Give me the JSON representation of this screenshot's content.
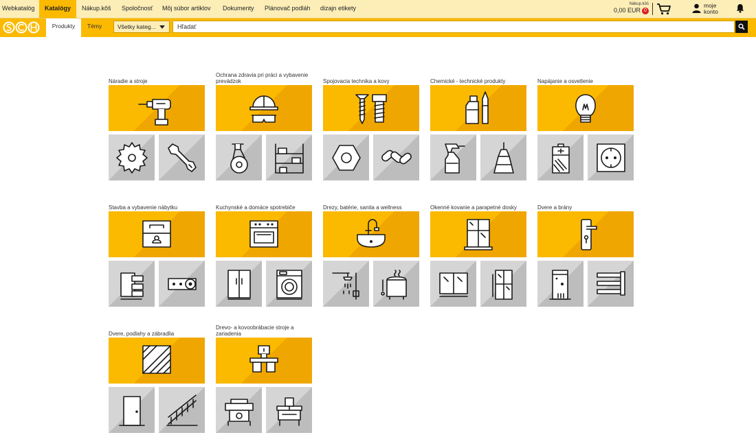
{
  "nav": {
    "items": [
      "Webkatalóg",
      "Katalógy",
      "Nákup.kôš",
      "Spoločnosť",
      "Môj súbor artiklov",
      "Dokumenty",
      "Plánovač podláh",
      "dizajn etikety"
    ],
    "active_index": 1
  },
  "cart": {
    "label": "Nákup.kôš",
    "amount": "0,00 EUR",
    "count": "0"
  },
  "account": {
    "label": "moje konto"
  },
  "searchbar": {
    "tab_products": "Produkty",
    "tab_topics": "Témy",
    "category_select": "Všetky kateg...",
    "search_placeholder": "Hľadať"
  },
  "colors": {
    "brand_yellow": "#fbb900",
    "nav_bg": "#fdeeb8",
    "tile_grey": "#d5d5d5",
    "badge_red": "#d81f26"
  },
  "categories": [
    {
      "title": "Náradie a stroje",
      "main_icon": "drill-icon",
      "sub_icons": [
        "saw-blade-icon",
        "wrench-icon"
      ]
    },
    {
      "title": "Ochrana zdravia pri práci a vybavenie prevádzok",
      "main_icon": "safety-helmet-goggles-icon",
      "sub_icons": [
        "castor-wheel-icon",
        "shelving-icon"
      ]
    },
    {
      "title": "Spojovacia technika a kovy",
      "main_icon": "screw-bolt-icon",
      "sub_icons": [
        "hex-nut-icon",
        "chain-icon"
      ]
    },
    {
      "title": "Chemické - technické produkty",
      "main_icon": "chemical-bottles-icon",
      "sub_icons": [
        "spray-bottle-icon",
        "glue-bottle-icon"
      ]
    },
    {
      "title": "Napájanie a osvetlenie",
      "main_icon": "light-bulb-icon",
      "sub_icons": [
        "battery-icon",
        "power-socket-icon"
      ]
    },
    {
      "title": "Stavba a vybavenie nábytku",
      "main_icon": "drawers-icon",
      "sub_icons": [
        "drawer-runners-icon",
        "hinge-icon"
      ]
    },
    {
      "title": "Kuchynské a domáce spotrebiče",
      "main_icon": "oven-icon",
      "sub_icons": [
        "fridge-icon",
        "washing-machine-icon"
      ]
    },
    {
      "title": "Drezy, batérie, sanita a wellness",
      "main_icon": "sink-faucet-icon",
      "sub_icons": [
        "shower-icon",
        "sauna-heater-icon"
      ]
    },
    {
      "title": "Okenné kovanie a parapetné dosky",
      "main_icon": "window-icon",
      "sub_icons": [
        "sliding-window-icon",
        "glass-door-icon"
      ]
    },
    {
      "title": "Dvere a brány",
      "main_icon": "door-handle-plate-icon",
      "sub_icons": [
        "door-lock-icon",
        "door-hinges-icon"
      ]
    },
    {
      "title": "Dvere, podlahy a zábradlia",
      "main_icon": "parquet-floor-icon",
      "sub_icons": [
        "door-icon",
        "railing-icon"
      ]
    },
    {
      "title": "Drevo- a kovoobrábacie stroje a zariadenia",
      "main_icon": "workbench-machine-icon",
      "sub_icons": [
        "planer-machine-icon",
        "cnc-machine-icon"
      ]
    }
  ]
}
